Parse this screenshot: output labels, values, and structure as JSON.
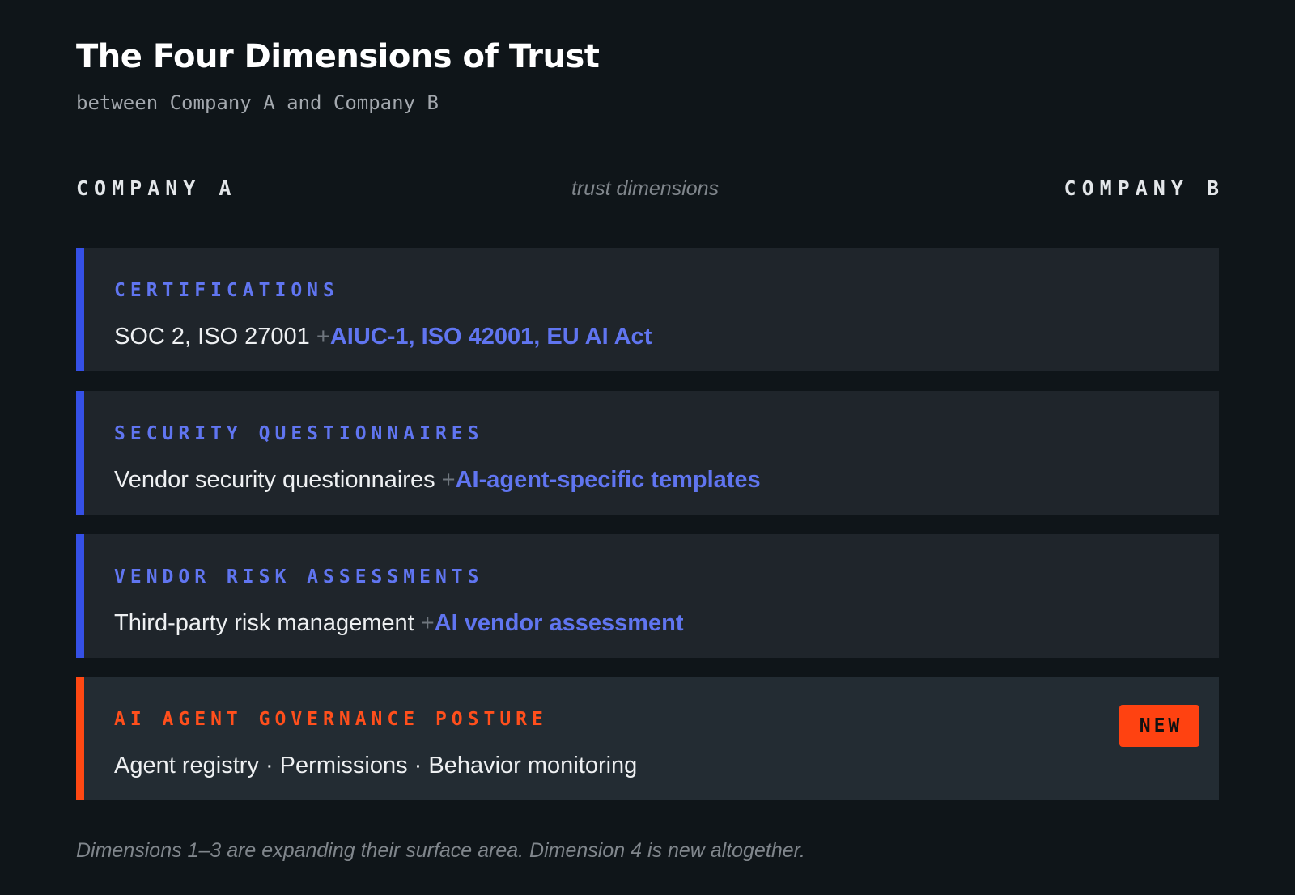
{
  "title": "The Four Dimensions of Trust",
  "subtitle": "between Company A and Company B",
  "parties": {
    "left": "COMPANY A",
    "connector": "trust dimensions",
    "right": "COMPANY B"
  },
  "dimensions": [
    {
      "label": "CERTIFICATIONS",
      "base": "SOC 2, ISO 27001",
      "plus": "+",
      "extra": "AIUC-1, ISO 42001, EU AI Act"
    },
    {
      "label": "SECURITY QUESTIONNAIRES",
      "base": "Vendor security questionnaires",
      "plus": "+",
      "extra": "AI-agent-specific templates"
    },
    {
      "label": "VENDOR RISK ASSESSMENTS",
      "base": "Third-party risk management",
      "plus": "+",
      "extra": "AI vendor assessment"
    },
    {
      "label": "AI AGENT GOVERNANCE POSTURE",
      "base": "Agent registry · Permissions · Behavior monitoring",
      "badge": "NEW"
    }
  ],
  "colors": {
    "background": "#0f1519",
    "card": "#1f252b",
    "accent_blue": "#3550e6",
    "label_blue": "#6075f0",
    "accent_orange": "#ff4813"
  },
  "footnote": "Dimensions 1–3 are expanding their surface area. Dimension 4 is new altogether."
}
